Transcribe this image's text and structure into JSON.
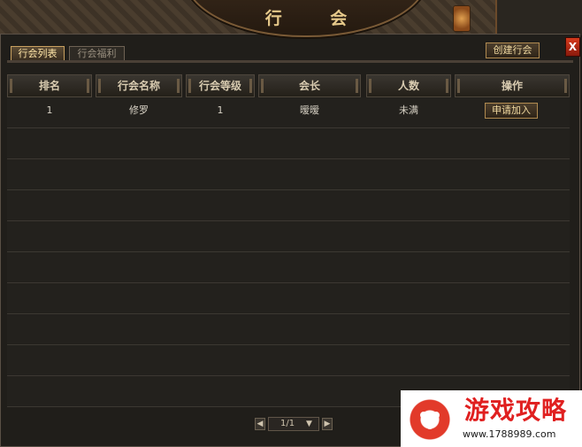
{
  "window": {
    "title": "行 会",
    "close_label": "X"
  },
  "tabs": [
    {
      "label": "行会列表",
      "active": true
    },
    {
      "label": "行会福利",
      "active": false
    }
  ],
  "toolbar": {
    "create_label": "创建行会"
  },
  "table": {
    "headers": [
      "排名",
      "行会名称",
      "行会等级",
      "会长",
      "人数",
      "操作"
    ],
    "rows": [
      {
        "rank": "1",
        "name": "修罗",
        "level": "1",
        "leader": "暧暧",
        "members": "未满",
        "action": "申请加入"
      }
    ],
    "empty_rows": 9
  },
  "pagination": {
    "page_text": "1/1",
    "prev_icon": "left-arrow-icon",
    "next_icon": "right-arrow-icon"
  },
  "watermark": {
    "title": "游戏攻略",
    "url": "www.1788989.com"
  },
  "colors": {
    "accent": "#e6c98a",
    "close": "#d63a1c",
    "watermark": "#e02020"
  }
}
